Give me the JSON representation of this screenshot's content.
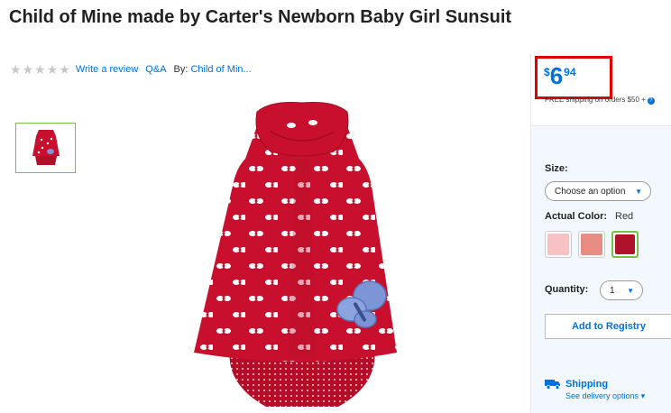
{
  "product": {
    "title": "Child of Mine made by Carter's Newborn Baby Girl Sunsuit",
    "write_review": "Write a review",
    "qa": "Q&A",
    "by_label": "By:",
    "brand": "Child of Min..."
  },
  "price": {
    "currency": "$",
    "dollars": "6",
    "cents": "94",
    "shipping_note": "FREE shipping on orders $50 +",
    "help": "?"
  },
  "options": {
    "size_label": "Size:",
    "size_value": "Choose an option",
    "color_label": "Actual Color:",
    "color_value": "Red",
    "swatches": [
      {
        "color": "#f6c2c4"
      },
      {
        "color": "#e88c84"
      },
      {
        "color": "#b0122a"
      }
    ],
    "quantity_label": "Quantity:",
    "quantity_value": "1"
  },
  "actions": {
    "registry": "Add to Registry"
  },
  "shipping": {
    "title": "Shipping",
    "delivery_link": "See delivery options"
  },
  "colors": {
    "accent": "#0071dc",
    "highlight": "#e00000",
    "selected": "#76c043",
    "garment": "#c8102e"
  }
}
